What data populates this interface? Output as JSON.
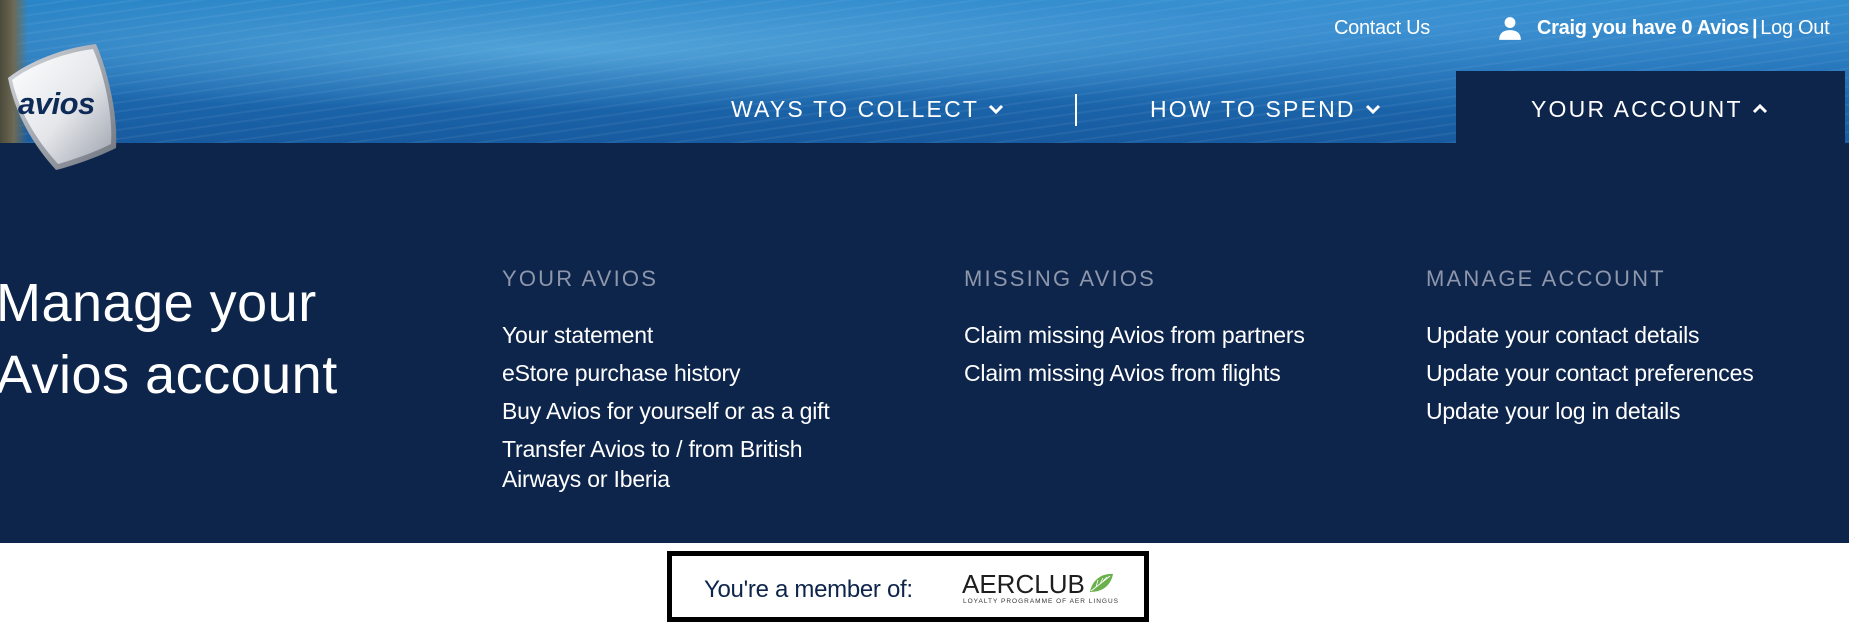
{
  "brand": {
    "logo_text": "avios"
  },
  "header": {
    "contact_label": "Contact Us",
    "account_greeting": "Craig you have 0 Avios",
    "account_separator": "|",
    "logout_label": "Log Out"
  },
  "nav": {
    "collect_label": "WAYS TO COLLECT",
    "spend_label": "HOW TO SPEND",
    "account_label": "YOUR ACCOUNT"
  },
  "mega_menu": {
    "title_line1": "Manage your",
    "title_line2": "Avios account",
    "columns": [
      {
        "heading": "YOUR AVIOS",
        "links": [
          "Your statement",
          "eStore purchase history",
          "Buy Avios for yourself or as a gift",
          "Transfer Avios to / from British Airways or Iberia"
        ]
      },
      {
        "heading": "MISSING AVIOS",
        "links": [
          "Claim missing Avios from partners",
          "Claim missing Avios from flights"
        ]
      },
      {
        "heading": "MANAGE ACCOUNT",
        "links": [
          "Update your contact details",
          "Update your contact preferences",
          "Update your log in details"
        ]
      }
    ]
  },
  "membership": {
    "label": "You're a member of:",
    "program_name": "AERCLUB",
    "program_tagline": "LOYALTY PROGRAMME OF AER LINGUS"
  },
  "colors": {
    "navy": "#0e254b",
    "muted_heading": "#8d96ab",
    "aerclub_green": "#6ab04c"
  }
}
